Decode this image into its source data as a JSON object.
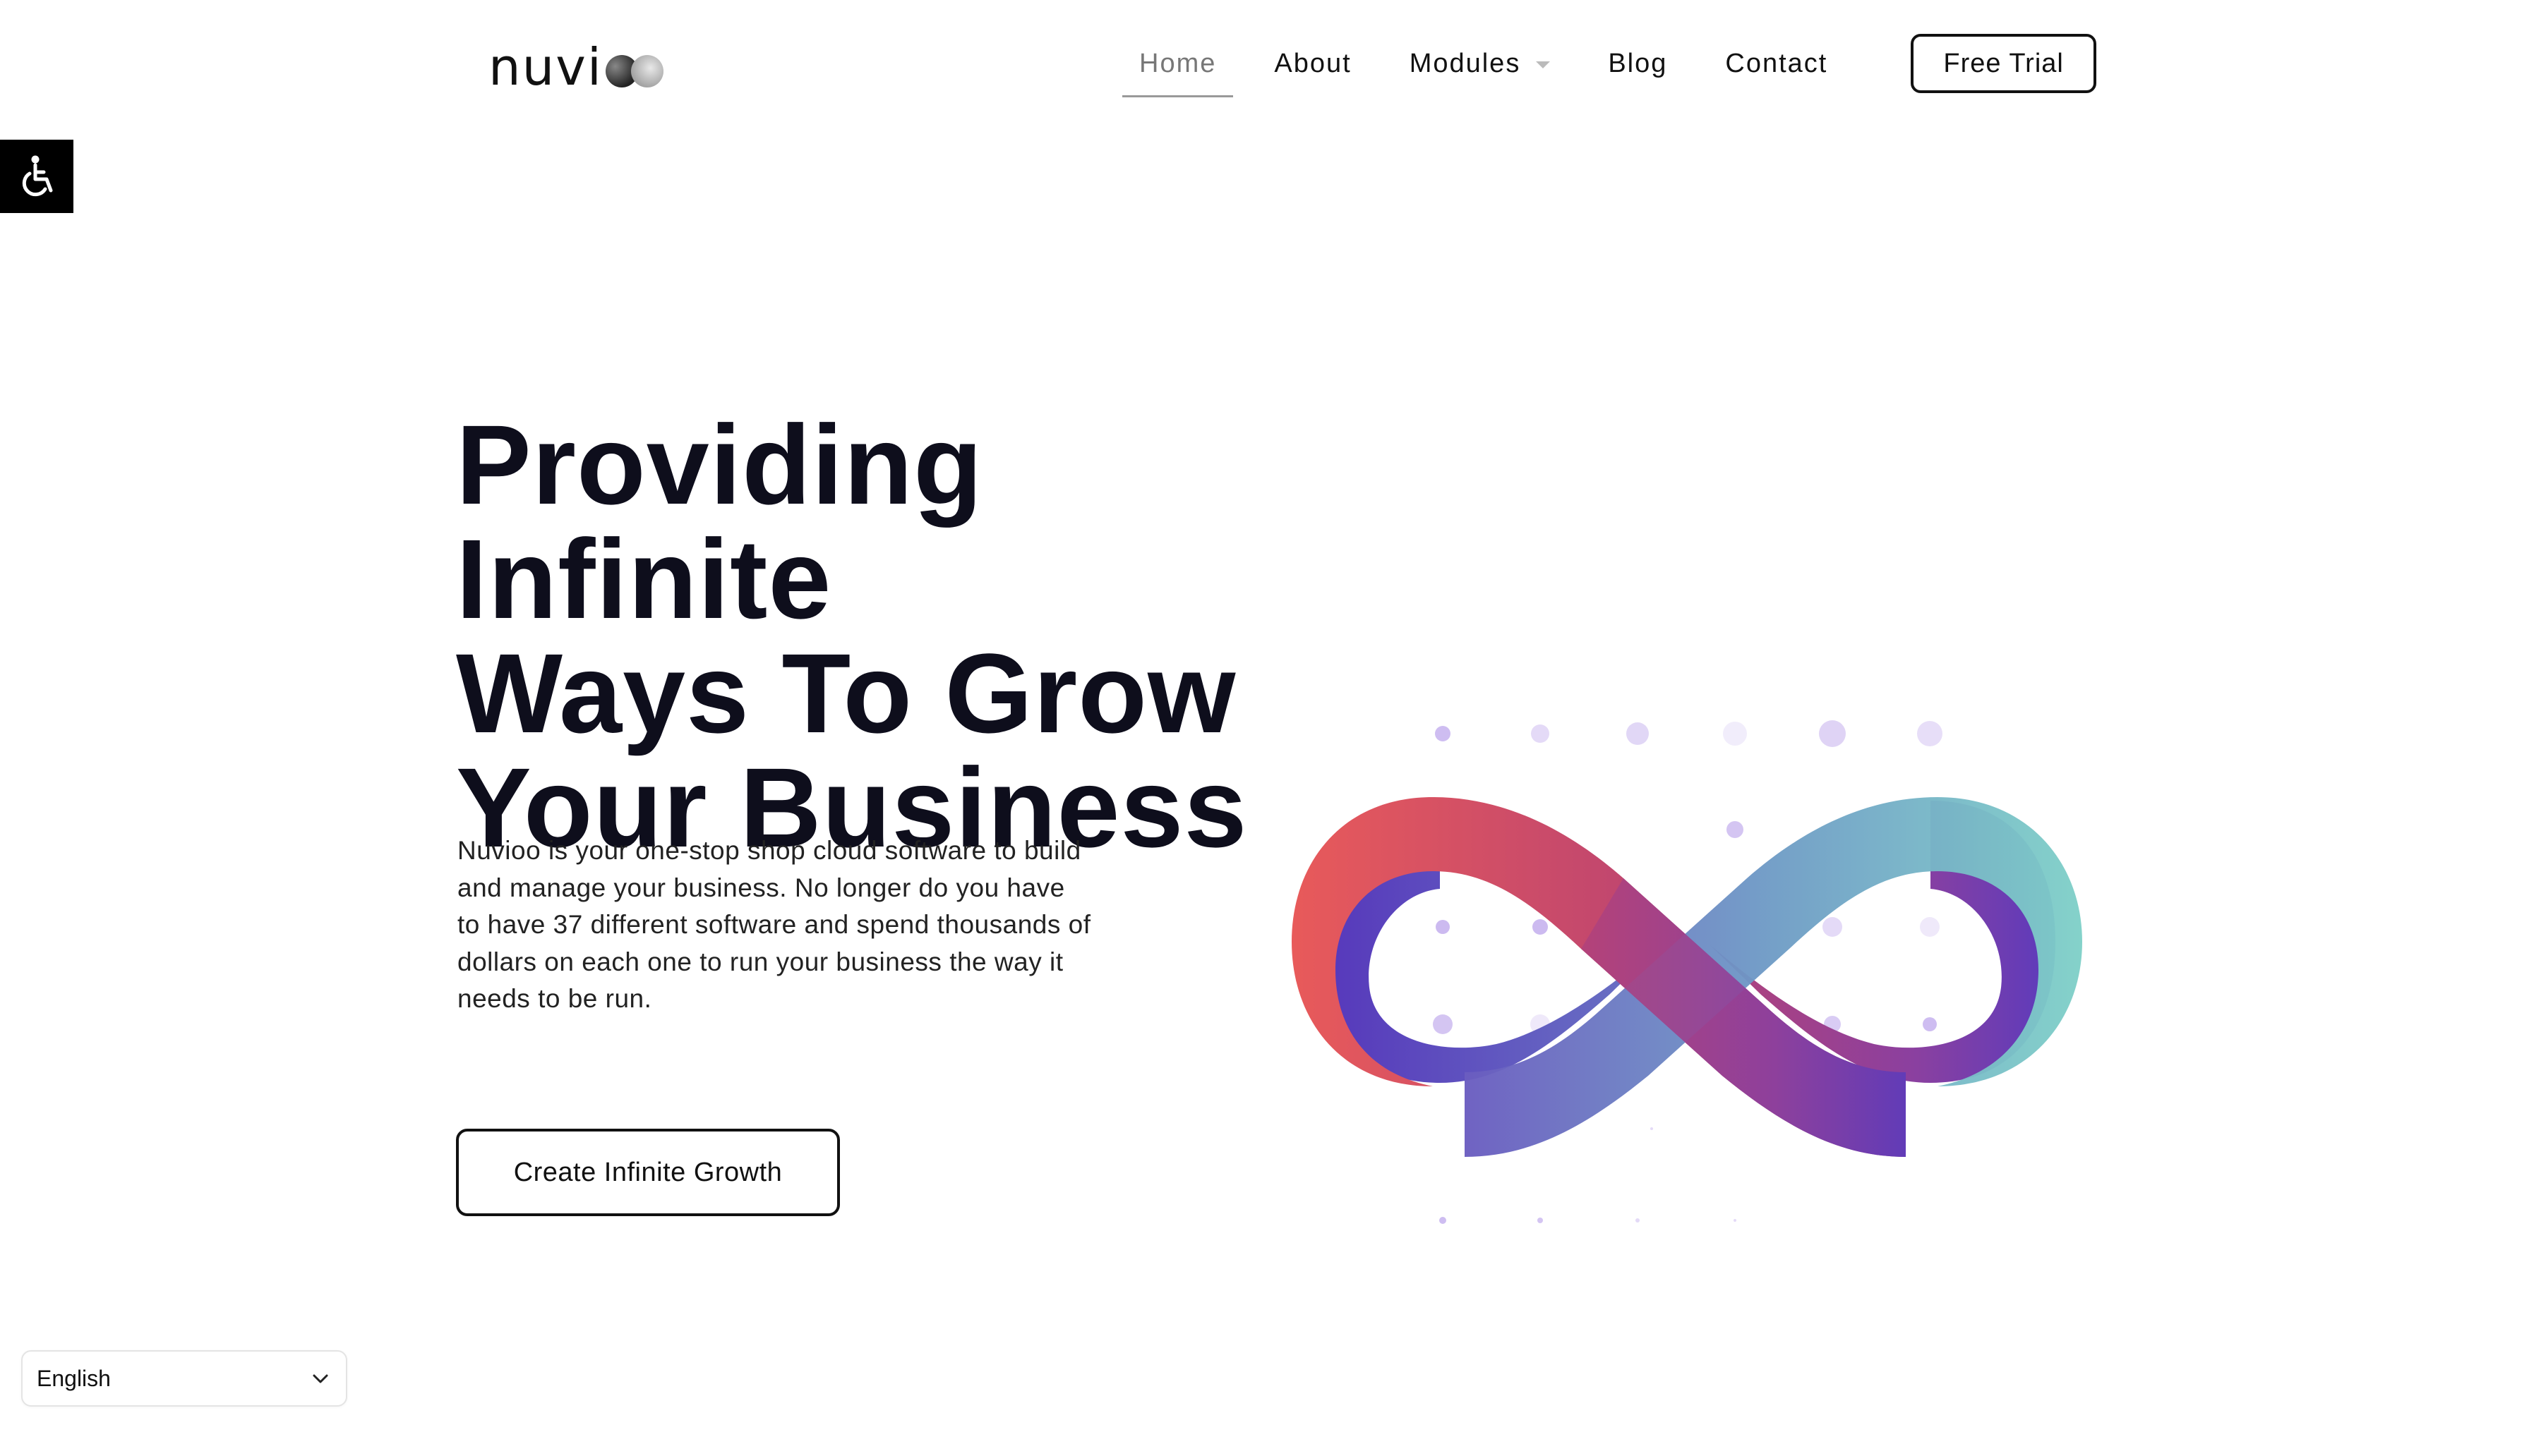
{
  "header": {
    "logo_text": "nuvi",
    "nav": [
      {
        "label": "Home",
        "active": true
      },
      {
        "label": "About",
        "active": false
      },
      {
        "label": "Modules",
        "active": false,
        "has_dropdown": true
      },
      {
        "label": "Blog",
        "active": false
      },
      {
        "label": "Contact",
        "active": false
      }
    ],
    "trial_button": "Free Trial"
  },
  "accessibility": {
    "icon": "wheelchair-icon"
  },
  "hero": {
    "title_lines": [
      "Providing Infinite",
      "Ways To Grow",
      "Your Business"
    ],
    "description": "Nuvioo is your one-stop shop cloud software to build and manage your business. No longer do you have to have 37 different software and spend thousands of dollars on each one to run your business the way it needs to be run.",
    "cta_label": "Create Infinite Growth"
  },
  "illustration": {
    "icon": "infinity-icon",
    "colors": {
      "red": "#e85a5a",
      "magenta": "#a8417e",
      "purple": "#5b3fbf",
      "teal": "#7ccfc8",
      "dot": "#c9b6ef"
    }
  },
  "language_select": {
    "value": "English",
    "icon": "chevron-down-icon"
  }
}
